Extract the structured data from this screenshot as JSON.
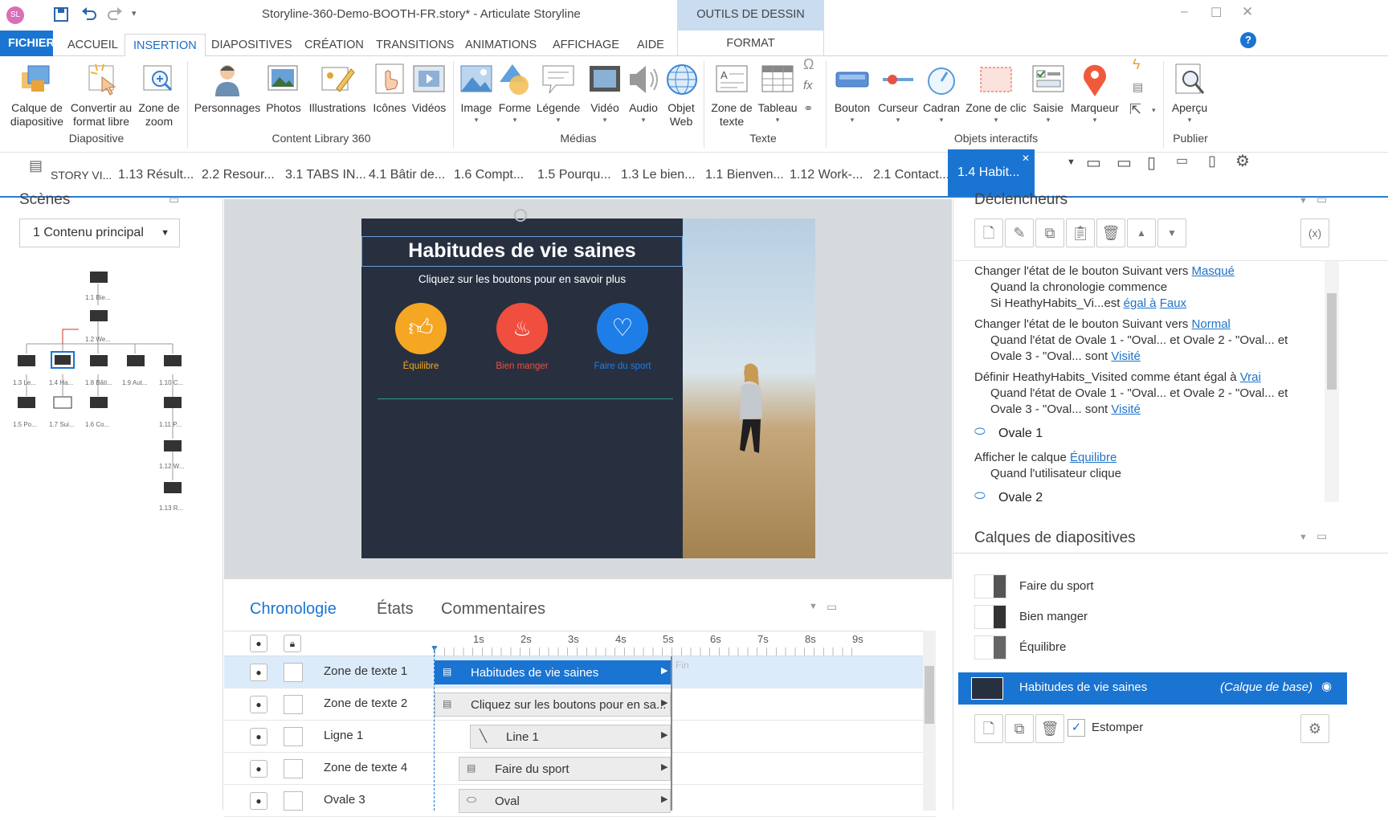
{
  "titlebar": {
    "file_title": "Storyline-360-Demo-BOOTH-FR.story* - Articulate Storyline",
    "contextual_group": "OUTILS DE DESSIN",
    "avatar": "SL"
  },
  "ribbon_tabs": [
    "FICHIER",
    "ACCUEIL",
    "INSERTION",
    "DIAPOSITIVES",
    "CRÉATION",
    "TRANSITIONS",
    "ANIMATIONS",
    "AFFICHAGE",
    "AIDE",
    "FORMAT"
  ],
  "ribbon": {
    "diapositive": {
      "btn1": "Calque de diapositive",
      "btn2": "Convertir au format libre",
      "btn3": "Zone de zoom",
      "group": "Diapositive"
    },
    "content": {
      "btn1": "Personnages",
      "btn2": "Photos",
      "btn3": "Illustrations",
      "btn4": "Icônes",
      "btn5": "Vidéos",
      "group": "Content Library 360"
    },
    "medias": {
      "btn1": "Image",
      "btn2": "Forme",
      "btn3": "Légende",
      "btn4": "Vidéo",
      "btn5": "Audio",
      "btn6": "Objet Web",
      "group": "Médias"
    },
    "texte": {
      "btn1": "Zone de texte",
      "btn2": "Tableau",
      "group": "Texte"
    },
    "objets": {
      "btn1": "Bouton",
      "btn2": "Curseur",
      "btn3": "Cadran",
      "btn4": "Zone de clic",
      "btn5": "Saisie",
      "btn6": "Marqueur",
      "group": "Objets interactifs"
    },
    "publier": {
      "btn1": "Aperçu",
      "group": "Publier"
    }
  },
  "slide_tabs": [
    "STORY VI...",
    "1.13 Résult...",
    "2.2 Resour...",
    "3.1 TABS IN...",
    "4.1 Bâtir de...",
    "1.6 Compt...",
    "1.5 Pourqu...",
    "1.3 Le bien...",
    "1.1 Bienven...",
    "1.12 Work-...",
    "2.1 Contact...",
    "1.4 Habit..."
  ],
  "scenes": {
    "title": "Scènes",
    "selected": "1 Contenu principal",
    "nodes": [
      "1.1 Bie...",
      "1.2 We...",
      "1.3 Le...",
      "1.4 Ha...",
      "1.8 Bâti...",
      "1.9 Aut...",
      "1.10 C...",
      "1.5 Po...",
      "1.7 Sui...",
      "1.6 Co...",
      "1.11 P...",
      "1.12 W...",
      "1.13 R..."
    ]
  },
  "slide": {
    "title": "Habitudes de vie saines",
    "subtitle": "Cliquez sur les boutons pour en savoir plus",
    "btn1": "Équilibre",
    "btn2": "Bien manger",
    "btn3": "Faire du sport",
    "colors": {
      "btn1": "#f5a623",
      "btn2": "#f04e3e",
      "btn3": "#1e7ee8"
    }
  },
  "timeline": {
    "tabs": [
      "Chronologie",
      "États",
      "Commentaires"
    ],
    "ticks": [
      "1s",
      "2s",
      "3s",
      "4s",
      "5s",
      "6s",
      "7s",
      "8s",
      "9s"
    ],
    "end_label": "Fin",
    "rows": [
      {
        "name": "Zone de texte 1",
        "bar": "Habitudes de vie saines"
      },
      {
        "name": "Zone de texte 2",
        "bar": "Cliquez sur les boutons pour en sa..."
      },
      {
        "name": "Ligne 1",
        "bar": "Line 1"
      },
      {
        "name": "Zone de texte 4",
        "bar": "Faire du sport"
      },
      {
        "name": "Ovale 3",
        "bar": "Oval"
      }
    ]
  },
  "triggers": {
    "title": "Déclencheurs",
    "t1": {
      "a": "Changer l'état de le bouton Suivant vers ",
      "a_link": "Masqué",
      "b": "Quand la chronologie commence",
      "c": "Si HeathyHabits_Vi...est ",
      "c_link1": "égal à",
      "c_link2": "Faux"
    },
    "t2": {
      "a": "Changer l'état de le bouton Suivant vers ",
      "a_link": "Normal",
      "b": "Quand l'état de Ovale 1 - \"Oval... et Ovale 2 - \"Oval... et",
      "c": "Ovale 3 - \"Oval... sont ",
      "c_link": "Visité"
    },
    "t3": {
      "a": "Définir HeathyHabits_Visited comme étant égal à ",
      "a_link": "Vrai",
      "b": "Quand l'état de Ovale 1 - \"Oval... et Ovale 2 - \"Oval... et",
      "c": "Ovale 3 - \"Oval... sont ",
      "c_link": "Visité"
    },
    "o1": "Ovale 1",
    "t4": {
      "a": "Afficher le calque ",
      "a_link": "Équilibre",
      "b": "Quand l'utilisateur clique"
    },
    "o2": "Ovale 2"
  },
  "layers": {
    "title": "Calques de diapositives",
    "items": [
      "Faire du sport",
      "Bien manger",
      "Équilibre"
    ],
    "base": "Habitudes de vie saines",
    "base_tag": "(Calque de base)",
    "dim_label": "Estomper"
  }
}
